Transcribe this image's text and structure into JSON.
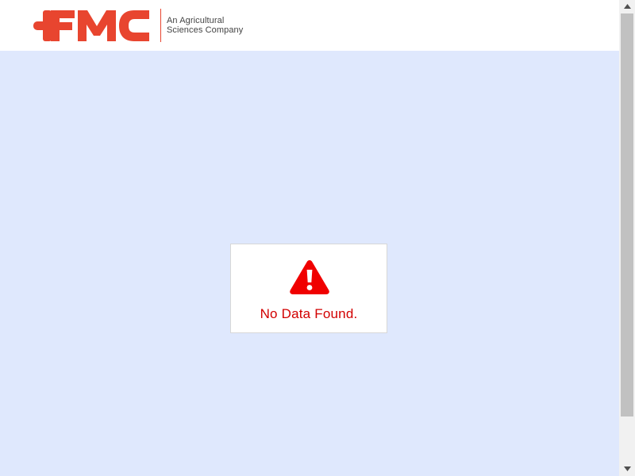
{
  "header": {
    "brand": "FMC",
    "tagline_line1": "An Agricultural",
    "tagline_line2": "Sciences Company",
    "brand_color": "#e8452f"
  },
  "main": {
    "background_color": "#dfe8fd",
    "empty_state": {
      "icon": "warning-triangle-icon",
      "message": "No Data Found.",
      "message_color": "#d20000"
    }
  },
  "scrollbar": {
    "up_icon": "chevron-up-icon",
    "down_icon": "chevron-down-icon"
  }
}
